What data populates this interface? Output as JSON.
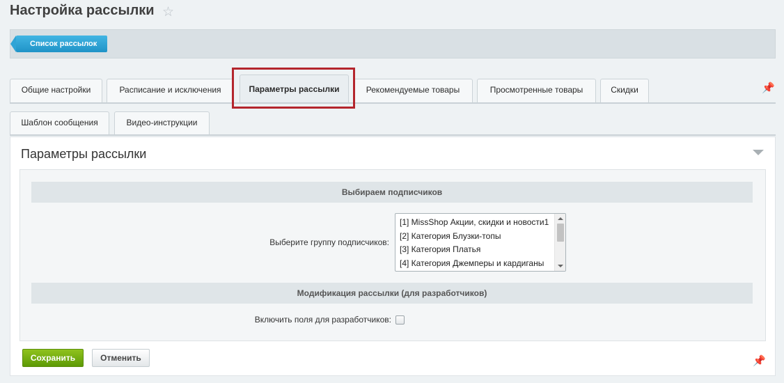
{
  "header": {
    "title": "Настройка рассылки",
    "star_icon": "star-icon"
  },
  "toolbar": {
    "list_button": "Список рассылок"
  },
  "tabs_row1": [
    {
      "label": "Общие настройки",
      "active": false
    },
    {
      "label": "Расписание и исключения",
      "active": false
    },
    {
      "label": "Параметры рассылки",
      "active": true
    },
    {
      "label": "Рекомендуемые товары",
      "active": false
    },
    {
      "label": "Просмотренные товары",
      "active": false
    },
    {
      "label": "Скидки",
      "active": false
    }
  ],
  "tabs_row2": [
    {
      "label": "Шаблон сообщения",
      "active": false
    },
    {
      "label": "Видео-инструкции",
      "active": false
    }
  ],
  "panel": {
    "title": "Параметры рассылки",
    "section1_title": "Выбираем подписчиков",
    "group_label": "Выберите группу подписчиков:",
    "groups": [
      "[1] MissShop Акции, скидки и новости1",
      "[2] Категория Блузки-топы",
      "[3] Категория Платья",
      "[4] Категория Джемперы и кардиганы"
    ],
    "section2_title": "Модификация рассылки (для разработчиков)",
    "dev_fields_label": "Включить поля для разработчиков:",
    "dev_fields_checked": false
  },
  "actions": {
    "save": "Сохранить",
    "cancel": "Отменить"
  },
  "colors": {
    "accent_blue": "#1f93c7",
    "save_green": "#6ba80b",
    "highlight_red": "#b4262d"
  }
}
